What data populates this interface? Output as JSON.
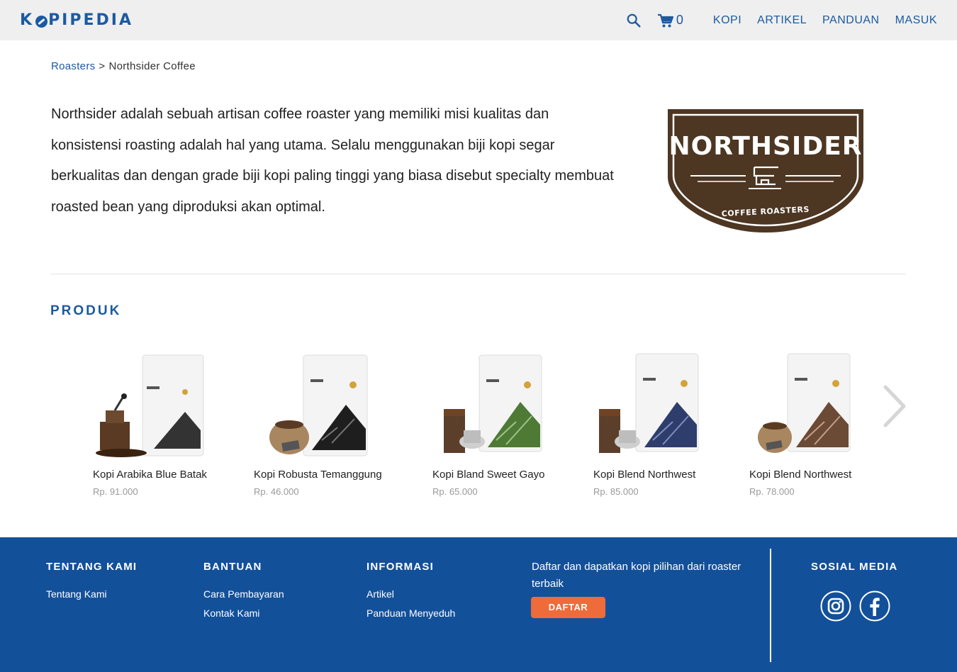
{
  "header": {
    "logo_text_1": "K",
    "logo_text_2": "PIPEDIA",
    "cart_count": "0",
    "nav": [
      "KOPI",
      "ARTIKEL",
      "PANDUAN",
      "MASUK"
    ]
  },
  "breadcrumb": {
    "parent": "Roasters",
    "separator": ">",
    "current": "Northsider Coffee"
  },
  "description": "Northsider adalah sebuah artisan coffee roaster yang memiliki misi kualitas dan konsistensi roasting adalah hal yang utama. Selalu menggunakan biji kopi segar berkualitas dan dengan grade biji kopi paling tinggi yang biasa disebut  specialty membuat roasted bean yang diproduksi akan optimal.",
  "brand_logo": {
    "name": "NORTHSIDER",
    "tagline": "COFFEE ROASTERS"
  },
  "section_title": "PRODUK",
  "products": [
    {
      "name": "Kopi Arabika Blue Batak",
      "price": "Rp. 91.000",
      "pattern_color": "#2a2a2a",
      "accent": "#444"
    },
    {
      "name": "Kopi Robusta Temanggung",
      "price": "Rp. 46.000",
      "pattern_color": "#1e1e1e",
      "accent": "#555"
    },
    {
      "name": "Kopi Bland Sweet Gayo",
      "price": "Rp. 65.000",
      "pattern_color": "#4e7a36",
      "accent": "#9fc48a"
    },
    {
      "name": "Kopi Blend Northwest",
      "price": "Rp. 85.000",
      "pattern_color": "#2e3d6b",
      "accent": "#7e8fc4"
    },
    {
      "name": "Kopi Blend Northwest",
      "price": "Rp. 78.000",
      "pattern_color": "#6b4a36",
      "accent": "#c4a08a"
    }
  ],
  "footer": {
    "col1": {
      "title": "TENTANG KAMI",
      "links": [
        "Tentang Kami"
      ]
    },
    "col2": {
      "title": "BANTUAN",
      "links": [
        "Cara Pembayaran",
        "Kontak Kami"
      ]
    },
    "col3": {
      "title": "INFORMASI",
      "links": [
        "Artikel",
        "Panduan Menyeduh"
      ]
    },
    "newsletter": "Daftar dan dapatkan kopi pilihan dari roaster terbaik",
    "button": "DAFTAR",
    "social_title": "SOSIAL MEDIA"
  },
  "colors": {
    "primary": "#1b5aa1",
    "footer_bg": "#13509a",
    "button": "#ef6b3a",
    "brand_brown": "#4d3622"
  },
  "icons": [
    "search-icon",
    "cart-icon",
    "chevron-right-icon",
    "instagram-icon",
    "facebook-icon"
  ]
}
